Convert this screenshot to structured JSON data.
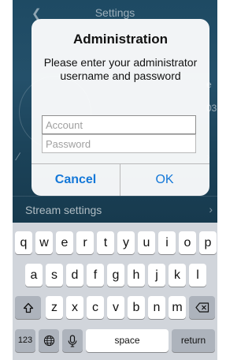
{
  "background": {
    "nav_title": "Settings",
    "stream_settings_label": "Stream settings",
    "partial_texts": [
      "e",
      "03"
    ]
  },
  "alert": {
    "title": "Administration",
    "message": "Please enter your administrator username and password",
    "account_placeholder": "Account",
    "password_placeholder": "Password",
    "cancel_label": "Cancel",
    "ok_label": "OK"
  },
  "keyboard": {
    "row1": [
      "q",
      "w",
      "e",
      "r",
      "t",
      "y",
      "u",
      "i",
      "o",
      "p"
    ],
    "row2": [
      "a",
      "s",
      "d",
      "f",
      "g",
      "h",
      "j",
      "k",
      "l"
    ],
    "row3": [
      "z",
      "x",
      "c",
      "v",
      "b",
      "n",
      "m"
    ],
    "numbers_label": "123",
    "space_label": "space",
    "return_label": "return"
  },
  "colors": {
    "accent": "#1478d8",
    "background_top": "#1e4a63",
    "keyboard_bg": "#d1d5db"
  }
}
